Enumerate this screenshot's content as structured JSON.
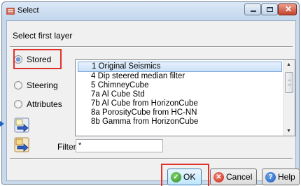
{
  "window": {
    "title": "Select"
  },
  "heading": "Select first layer",
  "options": [
    {
      "label": "Stored",
      "selected": true
    },
    {
      "label": "Steering",
      "selected": false
    },
    {
      "label": "Attributes",
      "selected": false
    }
  ],
  "list": {
    "selected_index": 0,
    "items": [
      "1 Original Seismics",
      "4 Dip steered median filter",
      "5 ChimneyCube",
      "7a Al Cube Std",
      "7b Al Cube from HorizonCube",
      "8a PorosityCube from HC-NN",
      "8b Gamma from HorizonCube"
    ]
  },
  "filter": {
    "label": "Filter",
    "value": "*"
  },
  "buttons": {
    "ok": "OK",
    "cancel": "Cancel",
    "help": "Help"
  },
  "colors": {
    "highlight_box": "#e0322c",
    "accent": "#2a66b5"
  }
}
